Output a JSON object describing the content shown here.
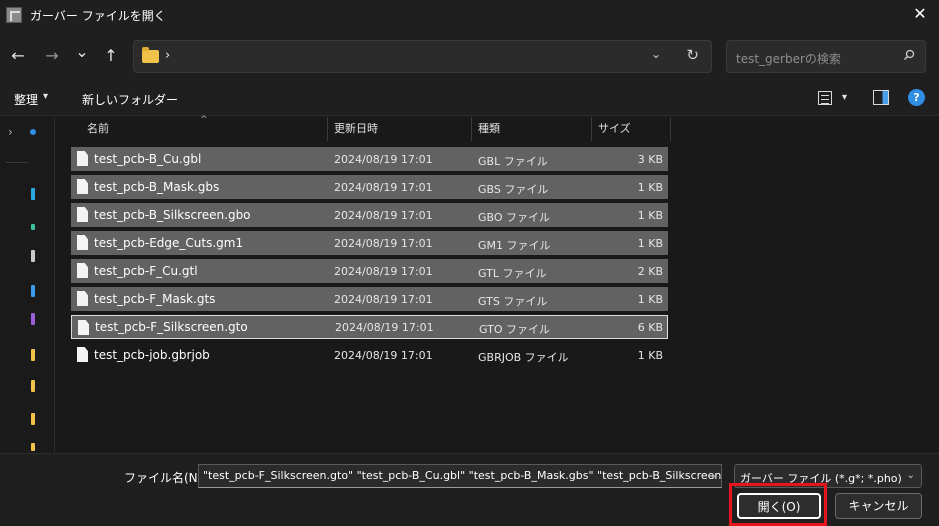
{
  "window": {
    "title": "ガーバー ファイルを開く",
    "close_glyph": "✕"
  },
  "nav": {
    "back_glyph": "←",
    "forward_glyph": "→",
    "recent_glyph": "⌄",
    "up_glyph": "↑",
    "address_chevron": "›",
    "address_dropdown": "⌄",
    "refresh_glyph": "↻",
    "search_placeholder": "test_gerberの検索"
  },
  "toolbar": {
    "organize_label": "整理",
    "organize_caret": "▾",
    "new_folder_label": "新しいフォルダー",
    "view_caret": "▾",
    "help_glyph": "?"
  },
  "sidebar": {
    "chevron": "›"
  },
  "columns": {
    "name": "名前",
    "modified": "更新日時",
    "type": "種類",
    "size": "サイズ",
    "sort_glyph": "^"
  },
  "files": [
    {
      "name": "test_pcb-B_Cu.gbl",
      "modified": "2024/08/19 17:01",
      "type": "GBL ファイル",
      "size": "3 KB"
    },
    {
      "name": "test_pcb-B_Mask.gbs",
      "modified": "2024/08/19 17:01",
      "type": "GBS ファイル",
      "size": "1 KB"
    },
    {
      "name": "test_pcb-B_Silkscreen.gbo",
      "modified": "2024/08/19 17:01",
      "type": "GBO ファイル",
      "size": "1 KB"
    },
    {
      "name": "test_pcb-Edge_Cuts.gm1",
      "modified": "2024/08/19 17:01",
      "type": "GM1 ファイル",
      "size": "1 KB"
    },
    {
      "name": "test_pcb-F_Cu.gtl",
      "modified": "2024/08/19 17:01",
      "type": "GTL ファイル",
      "size": "2 KB"
    },
    {
      "name": "test_pcb-F_Mask.gts",
      "modified": "2024/08/19 17:01",
      "type": "GTS ファイル",
      "size": "1 KB"
    },
    {
      "name": "test_pcb-F_Silkscreen.gto",
      "modified": "2024/08/19 17:01",
      "type": "GTO ファイル",
      "size": "6 KB"
    },
    {
      "name": "test_pcb-job.gbrjob",
      "modified": "2024/08/19 17:01",
      "type": "GBRJOB ファイル",
      "size": "1 KB"
    }
  ],
  "bottom": {
    "filename_label": "ファイル名(N):",
    "filename_value": "\"test_pcb-F_Silkscreen.gto\" \"test_pcb-B_Cu.gbl\" \"test_pcb-B_Mask.gbs\" \"test_pcb-B_Silkscreen.g",
    "filename_caret": "⌄",
    "filter_value": "ガーバー ファイル (*.g*; *.pho)",
    "filter_caret": "⌄",
    "open_label": "開く(O)",
    "cancel_label": "キャンセル"
  },
  "colors": {
    "selected_row": "#626262",
    "accent": "#2f8de4",
    "highlight": "#e8141c"
  }
}
